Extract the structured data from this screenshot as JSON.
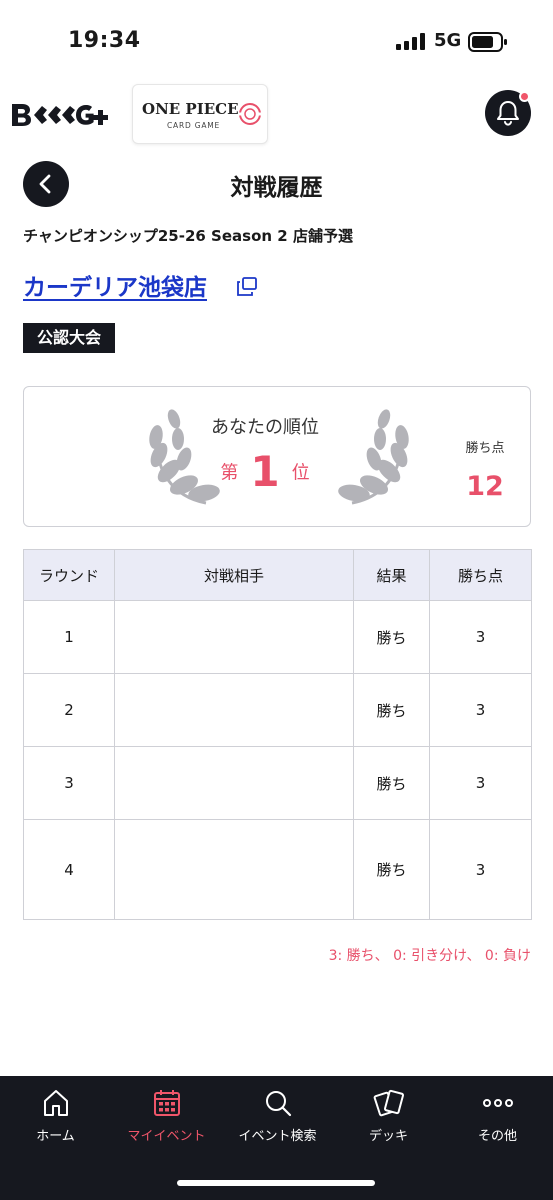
{
  "status_bar": {
    "time": "19:34",
    "network": "5G"
  },
  "header": {
    "app_logo_text": "B.G+",
    "game_logo_title": "ONE PIECE",
    "game_logo_subtitle": "CARD GAME",
    "notification_icon": "bell-icon",
    "has_notification": true
  },
  "page": {
    "title": "対戦履歴",
    "back_icon": "chevron-left-icon",
    "event_name": "チャンピオンシップ25-26 Season 2 店舗予選",
    "store_name": "カーデリア池袋店",
    "store_link_icon": "external-link-icon",
    "badge": "公認大会"
  },
  "rank_card": {
    "label": "あなたの順位",
    "prefix": "第",
    "rank": "1",
    "suffix": "位",
    "points_label": "勝ち点",
    "points": "12"
  },
  "table": {
    "headers": [
      "ラウンド",
      "対戦相手",
      "結果",
      "勝ち点"
    ],
    "rows": [
      {
        "round": "1",
        "opponent": "",
        "result": "勝ち",
        "points": "3"
      },
      {
        "round": "2",
        "opponent": "",
        "result": "勝ち",
        "points": "3"
      },
      {
        "round": "3",
        "opponent": "",
        "result": "勝ち",
        "points": "3"
      },
      {
        "round": "4",
        "opponent": "",
        "result": "勝ち",
        "points": "3"
      }
    ]
  },
  "legend": "3: 勝ち、 0: 引き分け、 0: 負け",
  "bottom_nav": {
    "items": [
      {
        "label": "ホーム",
        "icon": "home-icon",
        "active": false
      },
      {
        "label": "マイイベント",
        "icon": "calendar-icon",
        "active": true
      },
      {
        "label": "イベント検索",
        "icon": "search-icon",
        "active": false
      },
      {
        "label": "デッキ",
        "icon": "cards-icon",
        "active": false
      },
      {
        "label": "その他",
        "icon": "more-icon",
        "active": false
      }
    ]
  },
  "colors": {
    "accent": "#e8506a",
    "dark": "#16181f",
    "link": "#1b37c8",
    "table_header": "#eaebf6"
  }
}
